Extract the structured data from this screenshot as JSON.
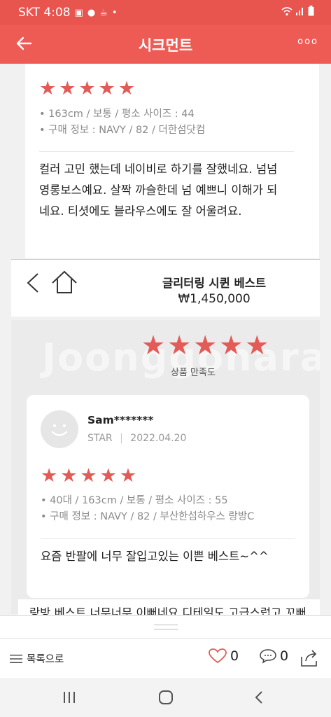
{
  "status_bar": {
    "carrier_time": "SKT 4:08",
    "icons": [
      "gallery-icon",
      "talk-icon",
      "coffee-icon",
      "dot-icon",
      "wifi-icon",
      "signal-icon",
      "battery-icon"
    ]
  },
  "header": {
    "title": "시크먼트",
    "back_icon": "back-arrow-icon",
    "more_label": "ooo"
  },
  "review_top": {
    "rating": 5,
    "stars": "★★★★★",
    "meta_line1": "• 163cm / 보통 / 평소 사이즈 : 44",
    "meta_line2": "• 구매 정보 : NAVY / 82 / 더한섬닷컴",
    "text_line1": "컬러 고민 했는데 네이비로 하기를 잘했네요. 넘넘",
    "text_line2": "영롱보스예요. 살짝 까슬한데 넘 예쁘니 이해가 되",
    "text_line3": "네요. 티셧에도 블라우스에도 잘 어울려요."
  },
  "product": {
    "name": "글리터링 시퀸 베스트",
    "price": "₩1,450,000"
  },
  "rating_summary": {
    "rating": 5,
    "stars": "★★★★★",
    "label": "상품 만족도",
    "watermark": "Joonggonara"
  },
  "review_second": {
    "username": "Sam*******",
    "grade": "STAR",
    "separator": "|",
    "date": "2022.04.20",
    "rating": 5,
    "stars": "★★★★★",
    "meta_line1": "• 40대 / 163cm / 보통 / 평소 사이즈 : 55",
    "meta_line2": "• 구매 정보 : NAVY / 82 / 부산한섬하우스 랑방C",
    "text": "요즘 반팔에 너무 잘입고있는 이쁜 베스트~^^"
  },
  "review_peek": {
    "text": "랑방 베스트 너무너무 이뻐네요 디테일도 고급스럽고 꼬뻐"
  },
  "bottom_bar": {
    "list_label": "목록으로",
    "like_count": "0",
    "comment_count": "0"
  },
  "colors": {
    "brand": "#ee5b55",
    "star": "#e25b57"
  }
}
